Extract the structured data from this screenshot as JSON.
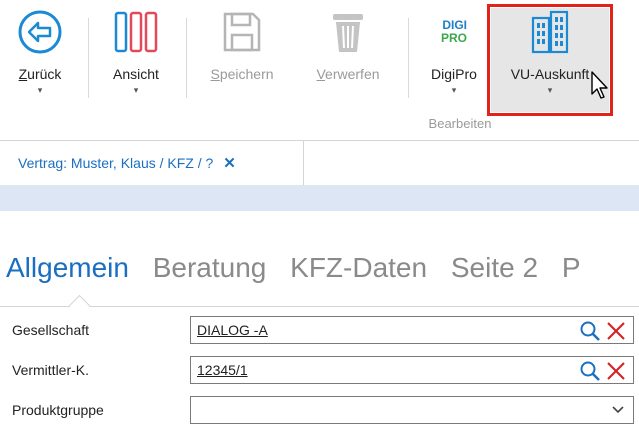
{
  "ribbon": {
    "back_label": "Zurück",
    "view_label": "Ansicht",
    "save_label": "Speichern",
    "discard_label": "Verwerfen",
    "digipro_label": "DigiPro",
    "digipro_logo_top": "DIGI",
    "digipro_logo_bottom": "PRO",
    "vu_label": "VU-Auskunft",
    "group_label": "Bearbeiten",
    "caret": "▾"
  },
  "tab": {
    "title": "Vertrag:  Muster, Klaus / KFZ / ?",
    "close": "✕"
  },
  "sections": [
    "Allgemein",
    "Beratung",
    "KFZ-Daten",
    "Seite 2",
    "P"
  ],
  "form": {
    "company_label": "Gesellschaft",
    "company_value": "DIALOG -A",
    "broker_label": "Vermittler-K.",
    "broker_value": "12345/1",
    "productgroup_label": "Produktgruppe",
    "productgroup_value": ""
  },
  "colors": {
    "accent": "#1a6fc1",
    "highlight": "#e2231a",
    "strip": "#dce6f4"
  }
}
